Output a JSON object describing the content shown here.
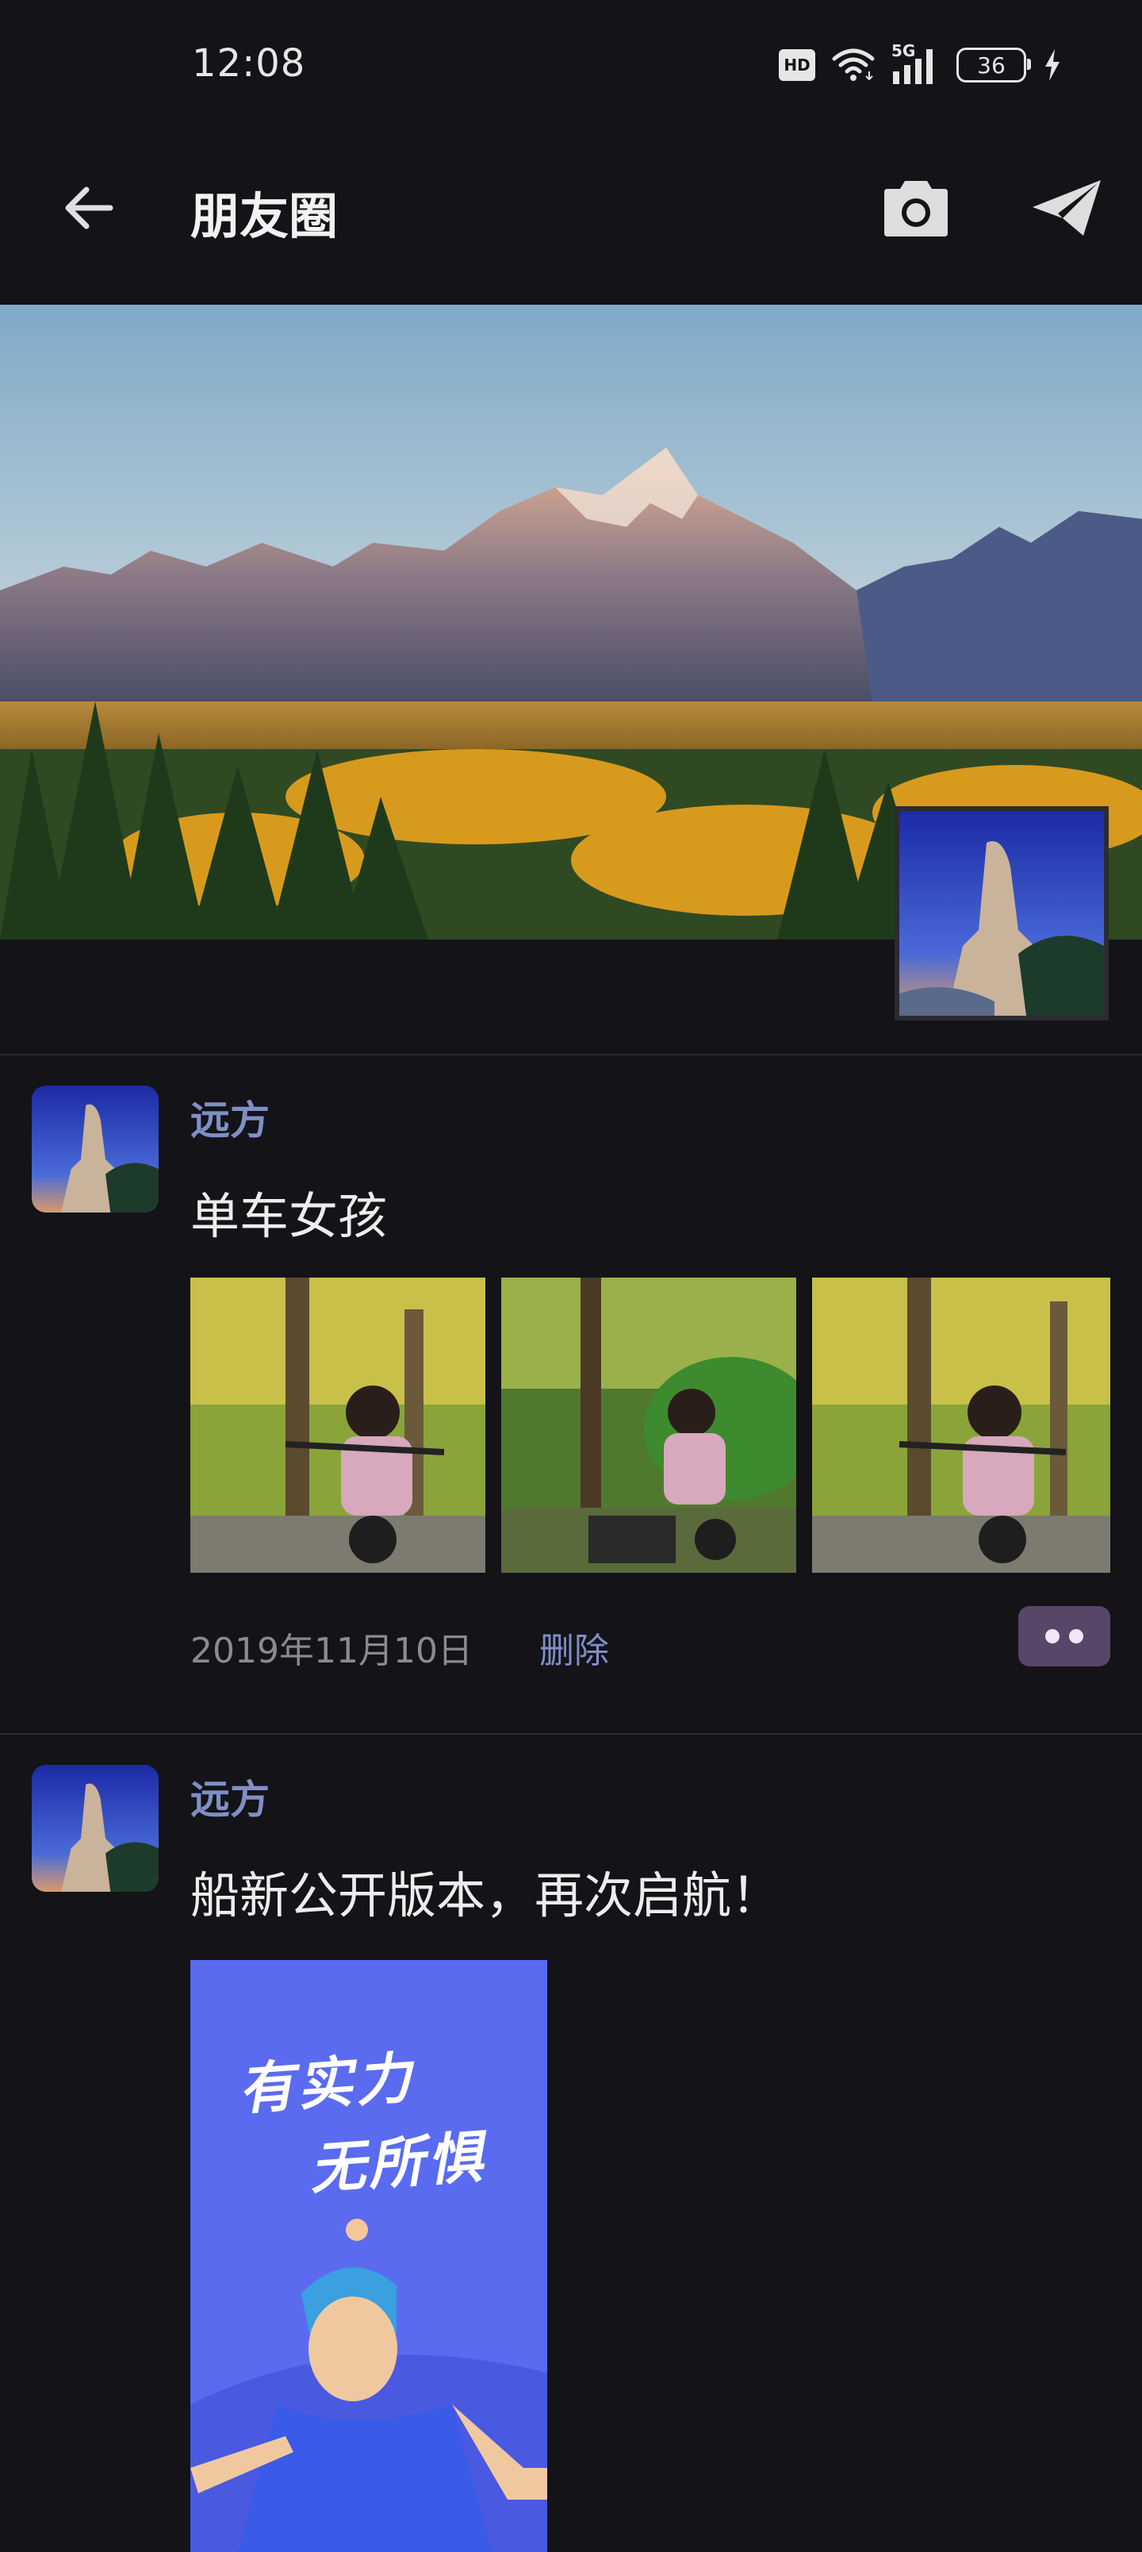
{
  "status_bar": {
    "time": "12:08",
    "network_badge": "HD",
    "network_type": "5G",
    "battery": "36",
    "icons": [
      "hd-icon",
      "wifi-icon",
      "signal-icon",
      "battery-icon",
      "charging-icon"
    ]
  },
  "header": {
    "title": "朋友圈",
    "back_icon": "arrow-left-icon",
    "camera_icon": "camera-icon",
    "send_icon": "paper-plane-icon"
  },
  "cover": {
    "image": "mountain-landscape-cover",
    "profile_avatar": "rock-peak-avatar"
  },
  "posts": [
    {
      "author": "远方",
      "text": "单车女孩",
      "photos": [
        "girl-on-scooter-photo-1",
        "girl-on-scooter-photo-2",
        "girl-on-scooter-photo-3"
      ],
      "date": "2019年11月10日",
      "delete_label": "删除",
      "more_icon": "more-dots-icon"
    },
    {
      "author": "远方",
      "text": "船新公开版本，再次启航！",
      "poster": {
        "line1": "有实力",
        "line2": "无所惧"
      }
    }
  ],
  "colors": {
    "background": "#131318",
    "accent_name": "#7f8fc6",
    "more_button": "#584668",
    "poster_blue": "#5b6bf0"
  }
}
